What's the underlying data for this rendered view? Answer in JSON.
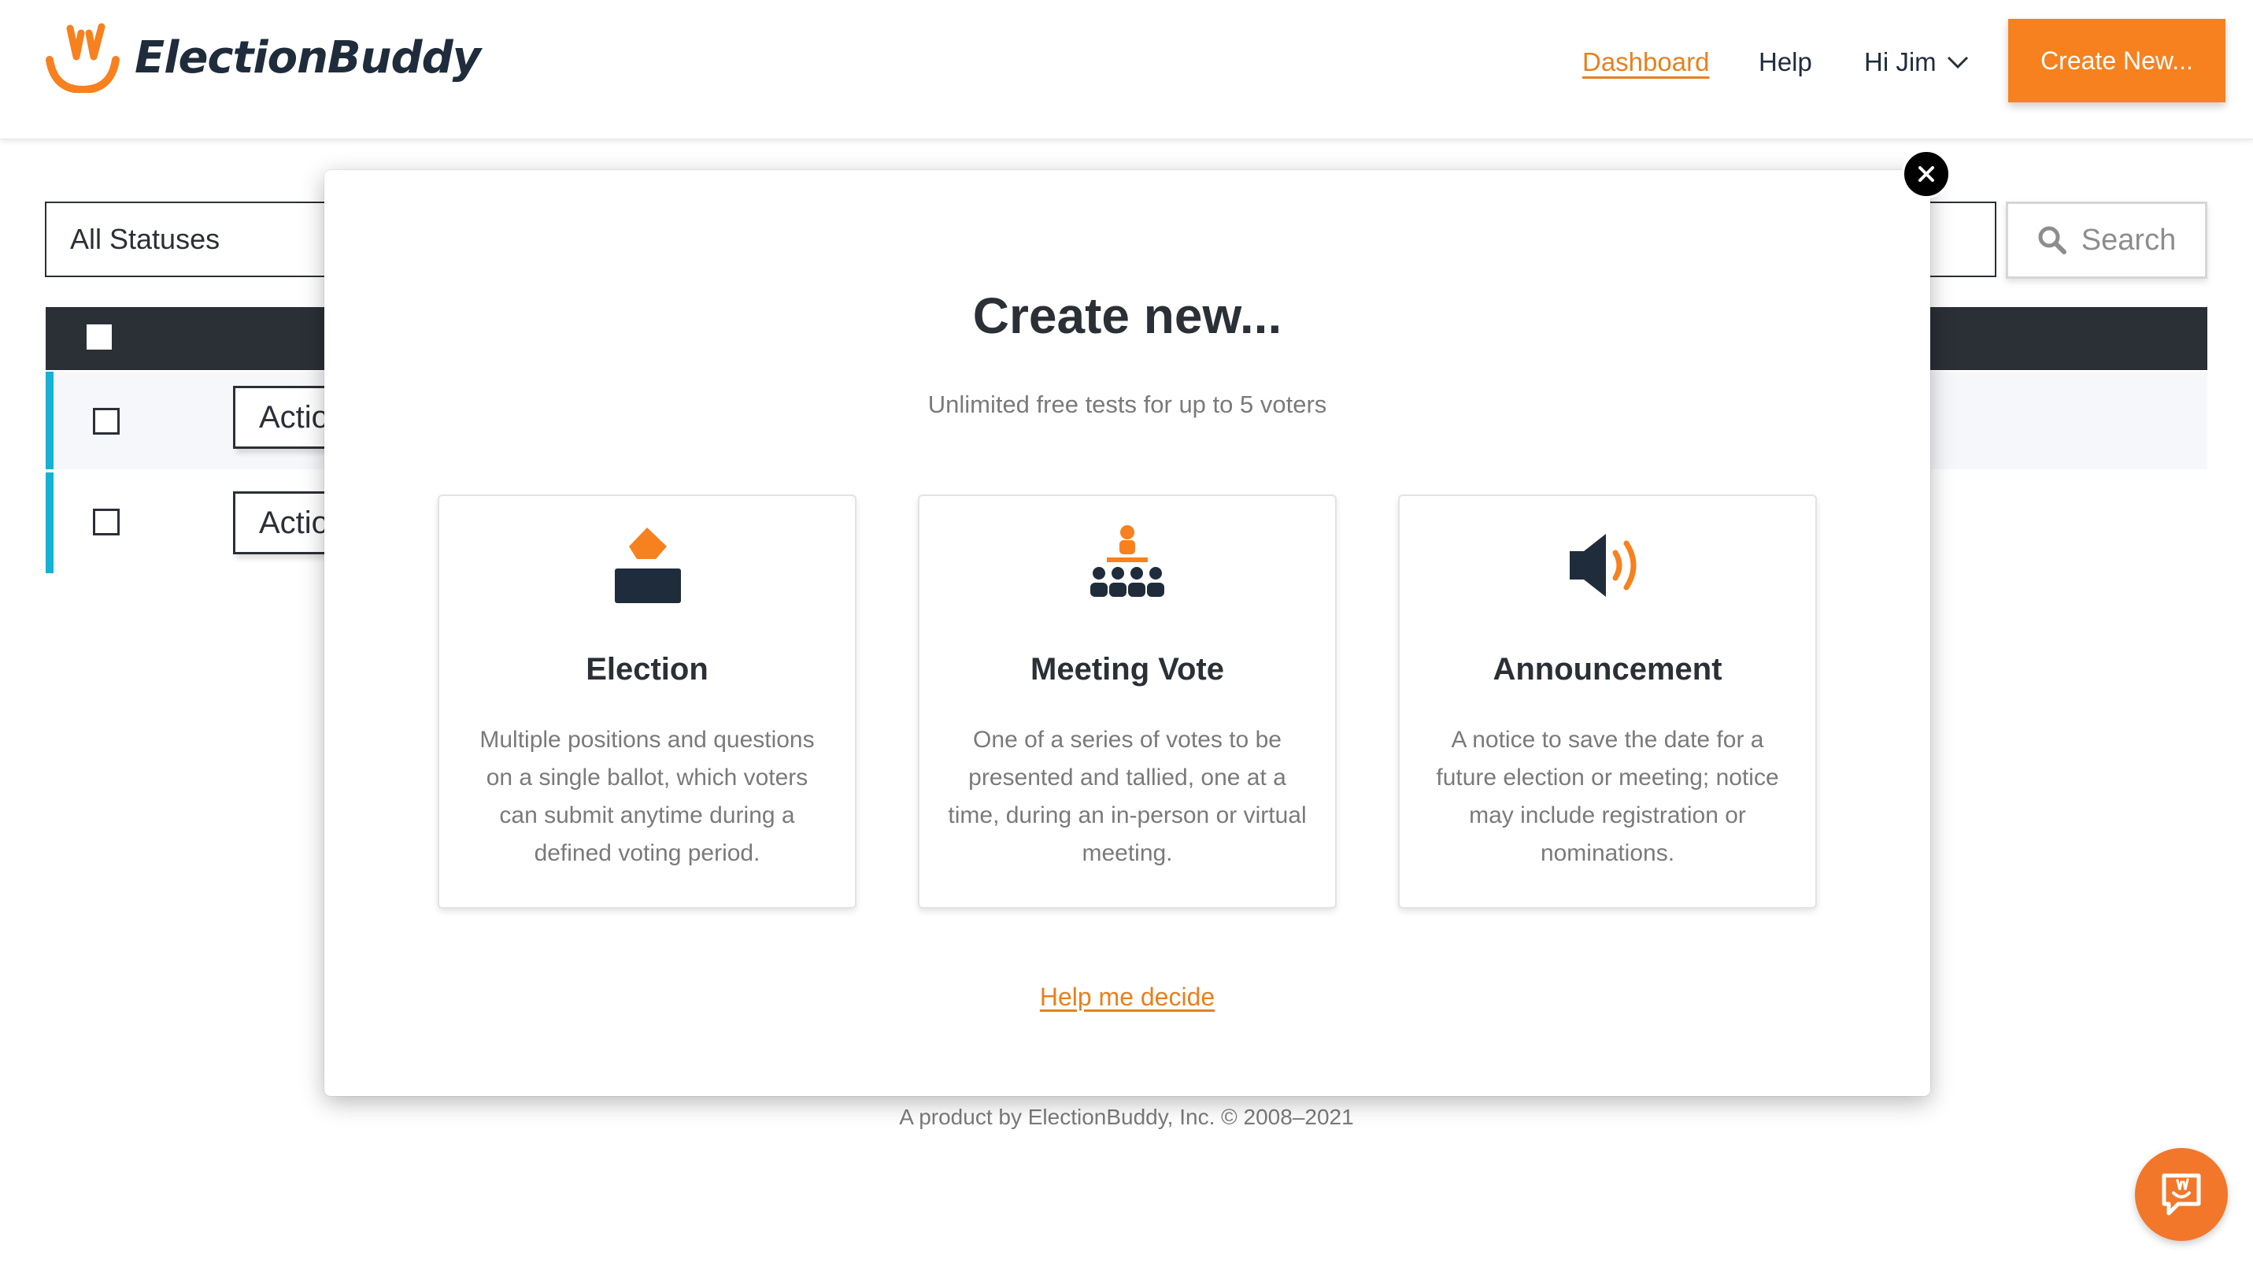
{
  "header": {
    "logo_text": "ElectionBuddy",
    "nav": {
      "dashboard": "Dashboard",
      "help": "Help",
      "user": "Hi Jim"
    },
    "create_button": "Create New..."
  },
  "filters": {
    "status_value": "All Statuses",
    "search_button": "Search"
  },
  "rows": [
    {
      "action_label": "Actio"
    },
    {
      "action_label": "Actio"
    }
  ],
  "footer": {
    "text": "A product by ElectionBuddy, Inc. © 2008–2021"
  },
  "modal": {
    "title": "Create new...",
    "subtitle": "Unlimited free tests for up to 5 voters",
    "cards": [
      {
        "title": "Election",
        "icon": "ballot-box-icon",
        "description": "Multiple positions and questions on a single ballot, which voters can submit anytime during a defined voting period."
      },
      {
        "title": "Meeting Vote",
        "icon": "meeting-icon",
        "description": "One of a series of votes to be presented and tallied, one at a time, during an in-person or virtual meeting."
      },
      {
        "title": "Announcement",
        "icon": "megaphone-icon",
        "description": "A notice to save the date for a future election or meeting; notice may include registration or nominations."
      }
    ],
    "help_link": "Help me decide"
  },
  "colors": {
    "brand_orange": "#f7811e",
    "navy": "#1f2c3b",
    "row_accent": "#17b1d4"
  }
}
